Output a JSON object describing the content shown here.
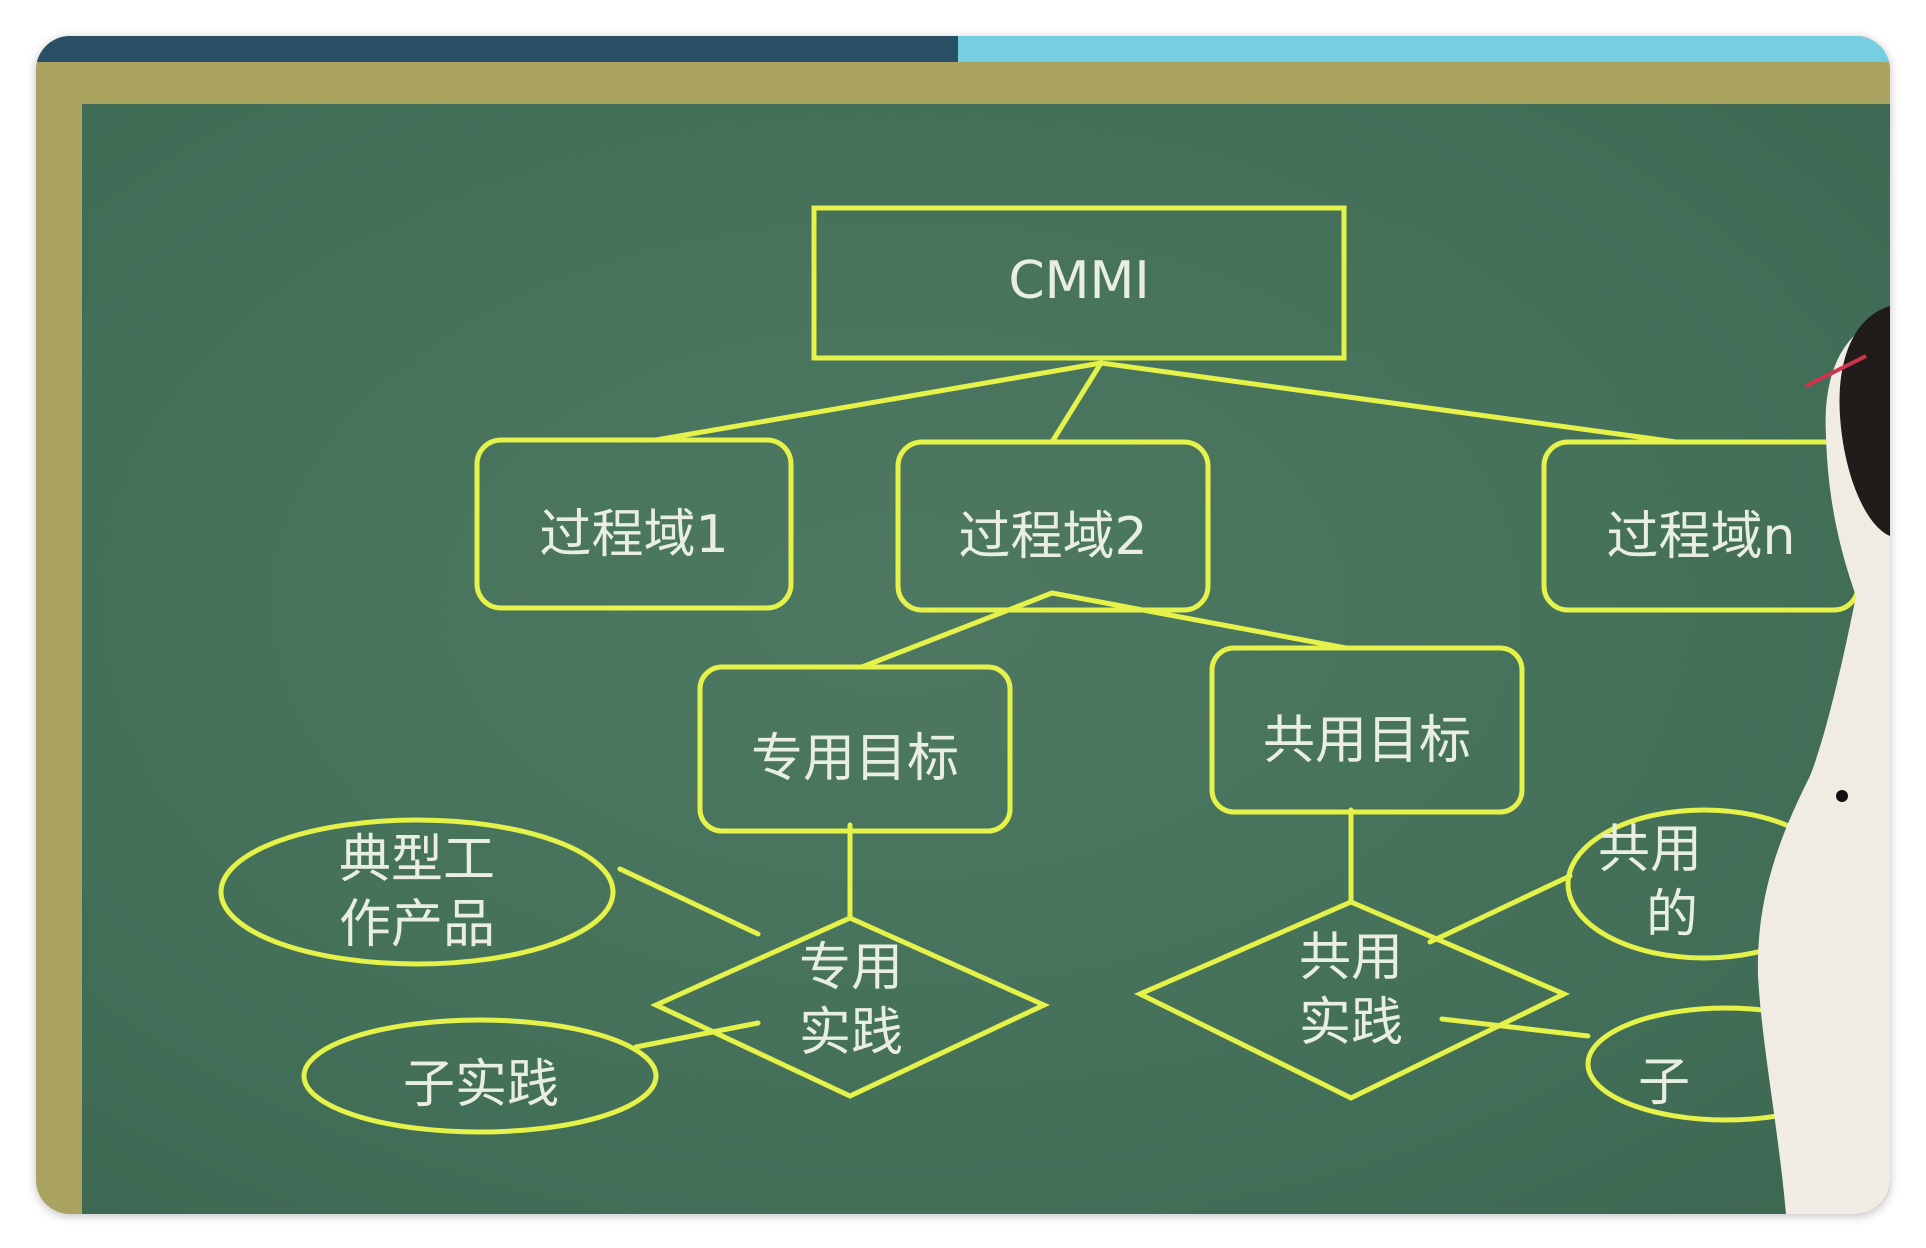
{
  "diagram": {
    "root": "CMMI",
    "process_areas": [
      "过程域1",
      "过程域2",
      "过程域n"
    ],
    "goals": {
      "specific": "专用目标",
      "generic": "共用目标"
    },
    "practices": {
      "specific": [
        "专用",
        "实践"
      ],
      "generic": [
        "共用",
        "实践"
      ]
    },
    "specific_attributes": {
      "work_products": [
        "典型工",
        "作产品"
      ],
      "subpractice": "子实践"
    },
    "generic_attributes_partial": {
      "elaborations": [
        "共用",
        "的"
      ],
      "subpractice": "子"
    }
  },
  "colors": {
    "board": "#44705a",
    "frame": "#a9a35f",
    "chalk_lines": "#e4f24a",
    "chalk_text": "#e8eee2"
  }
}
